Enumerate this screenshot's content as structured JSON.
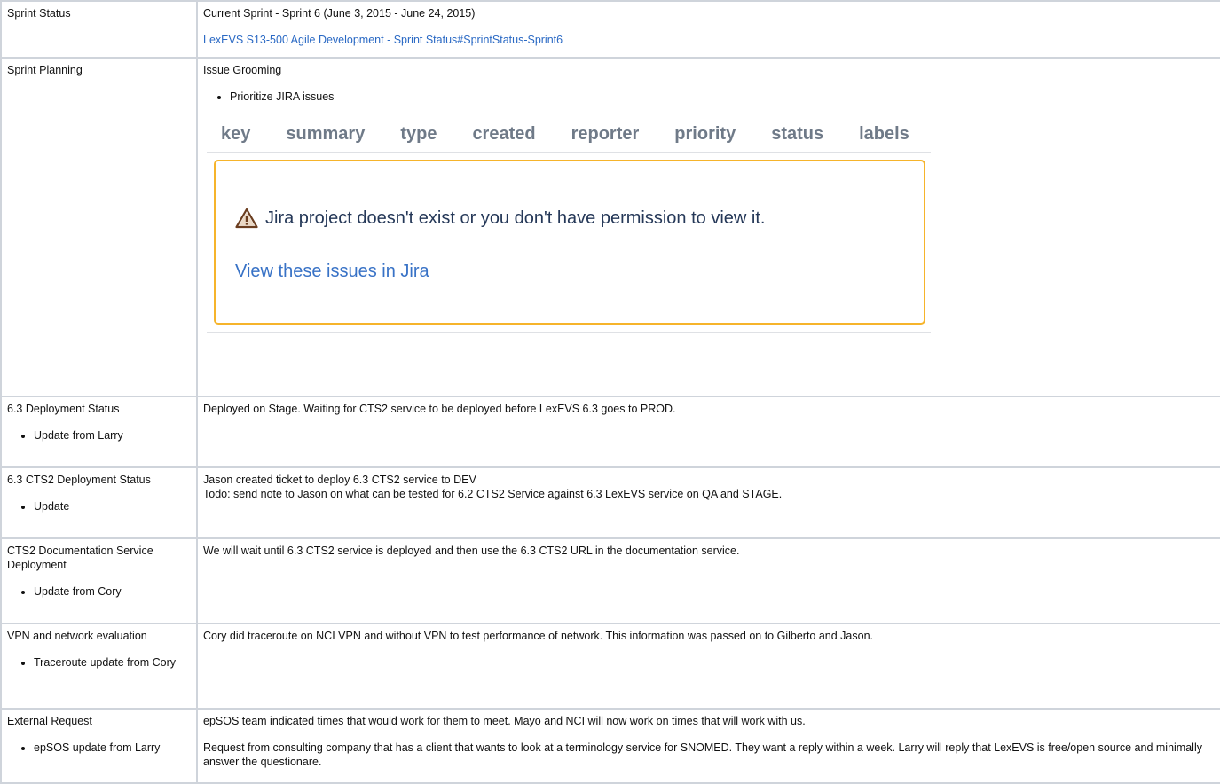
{
  "rows": [
    {
      "topic": "Sprint Status",
      "lines": [
        "Current Sprint - Sprint 6 (June 3, 2015 - June 24, 2015)"
      ],
      "link": "LexEVS S13-500 Agile Development - Sprint Status#SprintStatus-Sprint6"
    },
    {
      "topic": "Sprint Planning",
      "heading": "Issue Grooming",
      "bullet": "Prioritize JIRA issues",
      "jira": {
        "columns": [
          "key",
          "summary",
          "type",
          "created",
          "reporter",
          "priority",
          "status",
          "labels"
        ],
        "message": "Jira project doesn't exist or you don't have permission to view it.",
        "view_link": "View these issues in Jira"
      }
    },
    {
      "topic": "6.3 Deployment Status",
      "bullet": "Update from Larry",
      "notes": [
        "Deployed on Stage.  Waiting for CTS2 service to be deployed before LexEVS 6.3 goes to PROD."
      ]
    },
    {
      "topic": "6.3 CTS2 Deployment Status",
      "bullet": "Update",
      "notes": [
        "Jason created ticket to deploy 6.3 CTS2 service to DEV",
        "Todo: send note to Jason on what can be tested for 6.2 CTS2 Service against 6.3 LexEVS service on QA and STAGE."
      ]
    },
    {
      "topic": "CTS2 Documentation Service Deployment",
      "bullet": "Update from Cory",
      "notes": [
        "We will wait until 6.3 CTS2 service is deployed and then use the 6.3 CTS2 URL in the documentation service."
      ]
    },
    {
      "topic": "VPN and network evaluation",
      "bullet": "Traceroute update from Cory",
      "notes": [
        "Cory did traceroute on NCI VPN and without VPN to test performance of network.  This information was passed on to Gilberto and Jason."
      ]
    },
    {
      "topic": "External Request",
      "bullet": "epSOS update from Larry",
      "notes": [
        "epSOS team indicated times that would work for them to meet.  Mayo and NCI will now work on times that will work with us.",
        "Request from consulting company that has a client that wants to look at a terminology service for SNOMED.  They want a reply within a week.  Larry will reply that LexEVS is free/open source and minimally answer the questionare."
      ]
    }
  ],
  "colors": {
    "link": "#2a69c4",
    "warning_border": "#f6b42b",
    "header_text": "#6f7a88"
  },
  "icons": {
    "warning": "warning-triangle-icon"
  }
}
